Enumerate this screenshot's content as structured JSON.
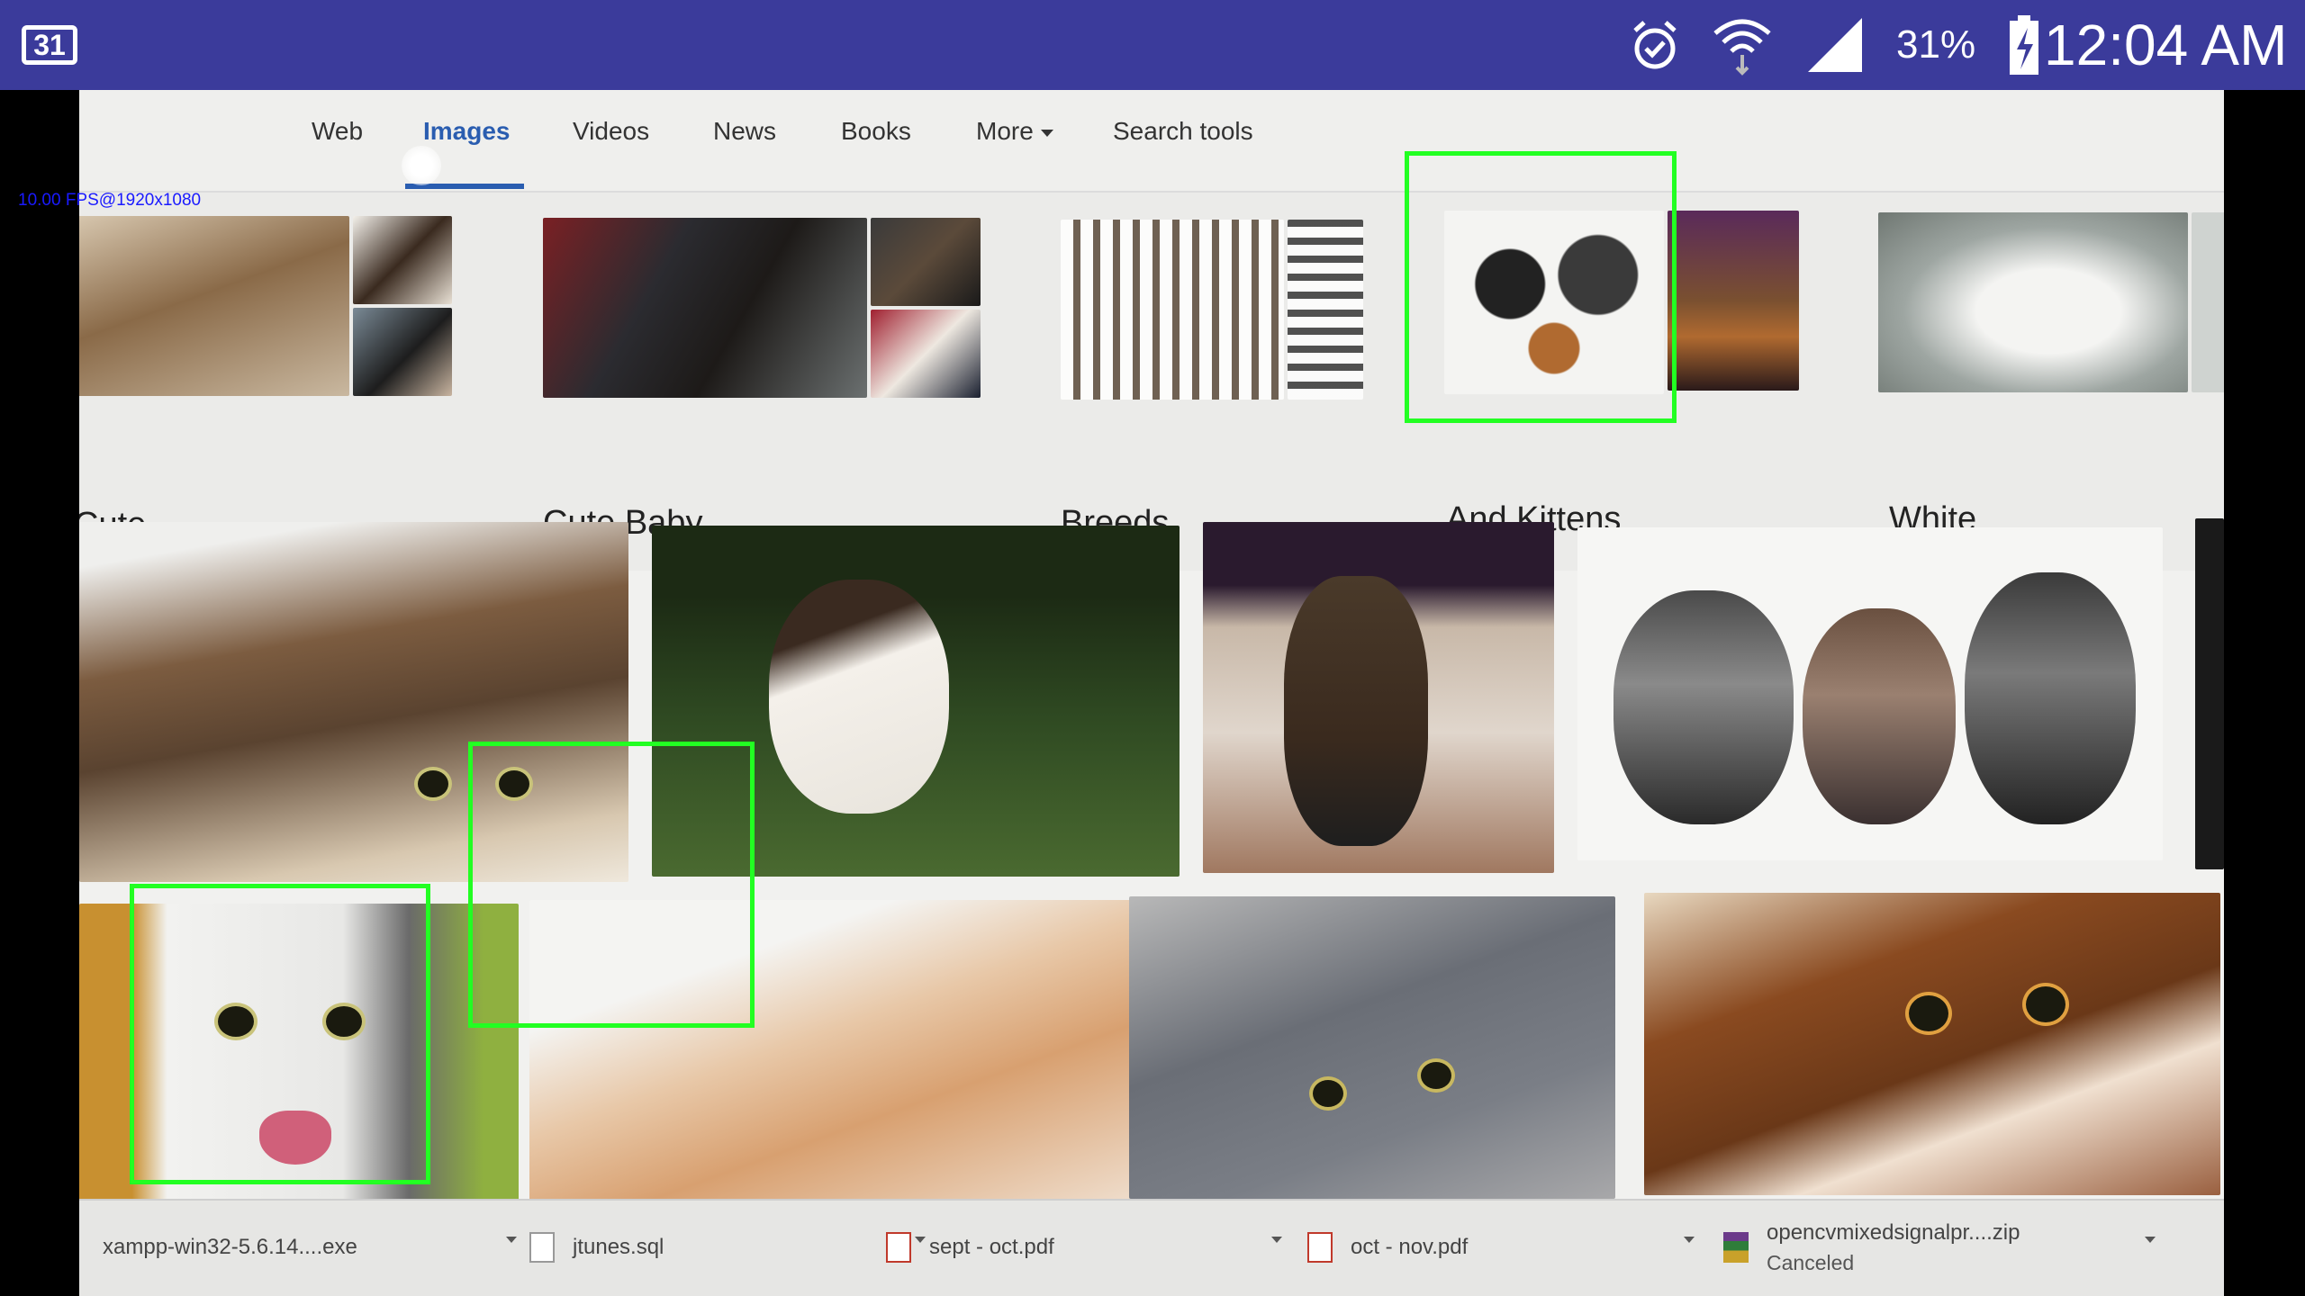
{
  "status_bar": {
    "calendar_day": "31",
    "battery_percent": "31%",
    "time": "12:04 AM",
    "icons": [
      "alarm-icon",
      "wifi-icon",
      "signal-icon",
      "battery-charging-icon"
    ]
  },
  "overlay": {
    "fps_text": "10.00 FPS@1920x1080"
  },
  "google": {
    "tabs": [
      {
        "label": "Web"
      },
      {
        "label": "Images"
      },
      {
        "label": "Videos"
      },
      {
        "label": "News"
      },
      {
        "label": "Books"
      },
      {
        "label": "More"
      },
      {
        "label": "Search tools"
      }
    ],
    "active_tab": "Images",
    "related_searches": [
      {
        "label": "Cute"
      },
      {
        "label": "Cute Baby"
      },
      {
        "label": "Breeds"
      },
      {
        "label": "And Kittens"
      },
      {
        "label": "White"
      }
    ]
  },
  "downloads": [
    {
      "name": "xampp-win32-5.6.14....exe",
      "icon": "file-icon"
    },
    {
      "name": "jtunes.sql",
      "icon": "file-icon"
    },
    {
      "name": "sept - oct.pdf",
      "icon": "pdf-icon"
    },
    {
      "name": "oct - nov.pdf",
      "icon": "pdf-icon"
    },
    {
      "name": "opencvmixedsignalpr....zip",
      "status": "Canceled",
      "icon": "zip-icon"
    }
  ],
  "colors": {
    "status_bar": "#3b3b9b",
    "detection_box": "#22ff22",
    "active_tab": "#2a5db0"
  }
}
